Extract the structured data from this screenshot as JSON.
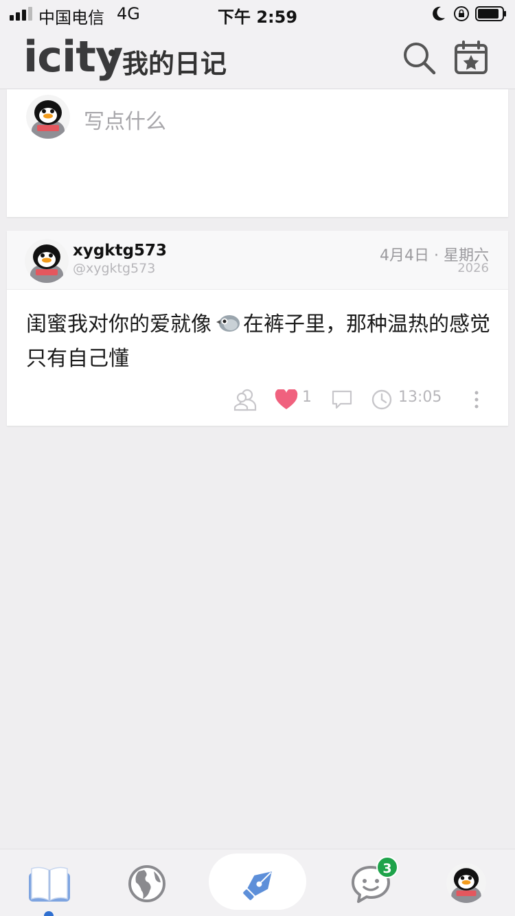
{
  "status_bar": {
    "carrier": "中国电信",
    "network": "4G",
    "time": "下午 2:59"
  },
  "header": {
    "logo": "icity",
    "title": "我的日记",
    "icons": [
      "search-icon",
      "calendar-star-icon"
    ]
  },
  "compose": {
    "placeholder": "写点什么"
  },
  "post": {
    "username": "xygktg573",
    "handle": "@xygktg573",
    "date": "4月4日 · 星期六",
    "year": "2026",
    "text_before": "闺蜜我对你的爱就像",
    "emoji": "bird-emoji",
    "text_after": "在裤子里，那种温热的感觉只有自己懂",
    "likes": "1",
    "time": "13:05"
  },
  "tab_bar": {
    "items": [
      "diary-book-icon",
      "world-globe-icon",
      "pen-nib-icon",
      "chat-bubble-icon",
      "profile-avatar"
    ],
    "message_badge": "3"
  },
  "colors": {
    "accent_blue": "#2f6fd0",
    "heart": "#f0617e",
    "badge_green": "#1ea34a",
    "background": "#efeef0"
  }
}
